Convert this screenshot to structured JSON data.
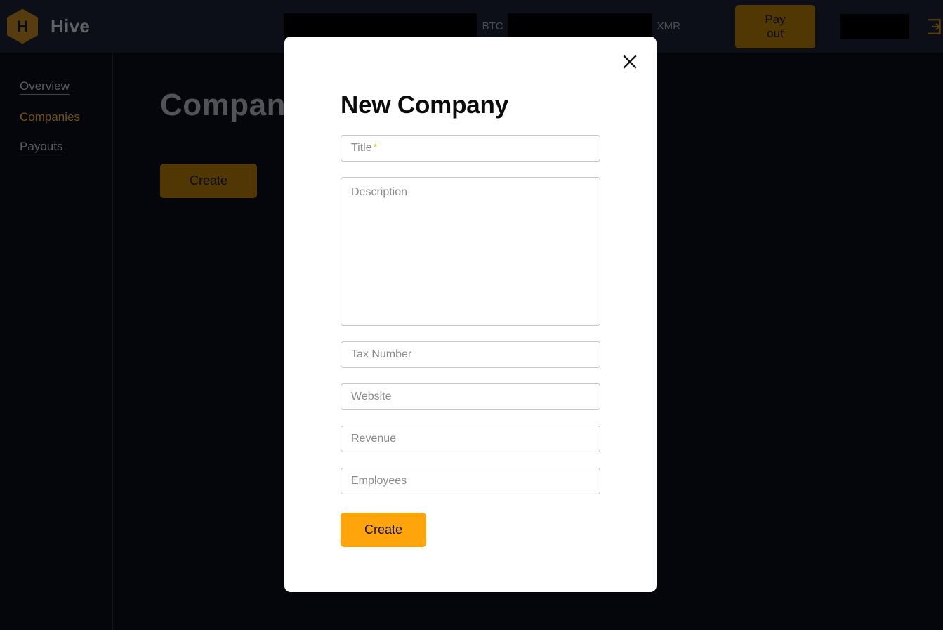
{
  "header": {
    "logo_letter": "H",
    "brand_name": "Hive",
    "btc_value": "",
    "btc_label": "BTC",
    "xmr_value": "",
    "xmr_label": "XMR",
    "payout_label": "Pay out",
    "user_value": "",
    "logout_icon": "logout-icon"
  },
  "sidebar": {
    "items": [
      {
        "label": "Overview",
        "active": false
      },
      {
        "label": "Companies",
        "active": true
      },
      {
        "label": "Payouts",
        "active": false
      }
    ]
  },
  "main": {
    "page_title": "Companies",
    "create_label": "Create"
  },
  "modal": {
    "title": "New Company",
    "close_icon": "close-icon",
    "fields": {
      "title": {
        "placeholder": "Title",
        "value": "",
        "required_marker": "*"
      },
      "description": {
        "placeholder": "Description",
        "value": ""
      },
      "tax_number": {
        "placeholder": "Tax Number",
        "value": ""
      },
      "website": {
        "placeholder": "Website",
        "value": ""
      },
      "revenue": {
        "placeholder": "Revenue",
        "value": ""
      },
      "employees": {
        "placeholder": "Employees",
        "value": ""
      }
    },
    "submit_label": "Create"
  },
  "colors": {
    "accent_amber": "#c88a11",
    "accent_orange": "#ffa50b",
    "button_dim": "#8b5f06",
    "background_dark": "#070b14",
    "header_dark": "#151b28",
    "modal_white": "#ffffff",
    "required_star": "#f5a623"
  }
}
